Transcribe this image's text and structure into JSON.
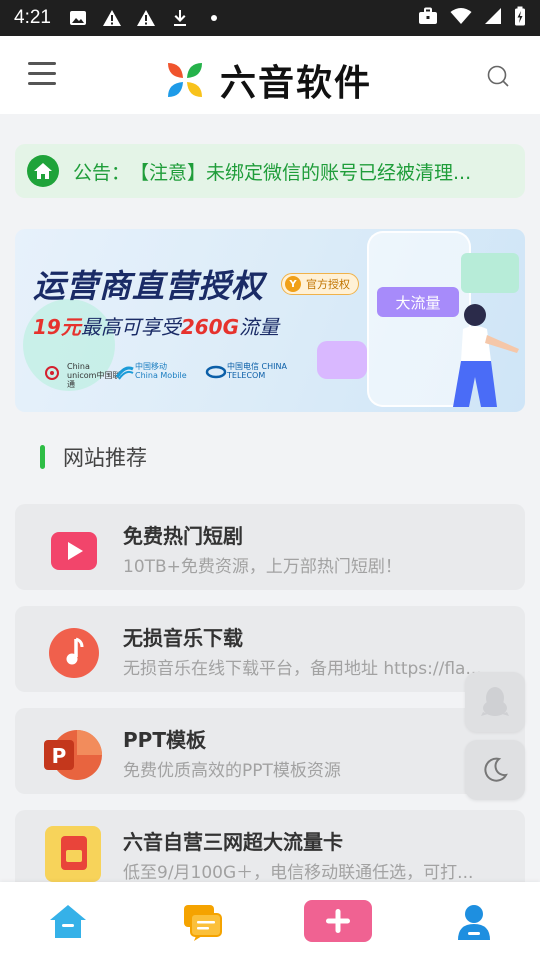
{
  "status_bar": {
    "time": "4:21",
    "icons_left": [
      "image-icon",
      "warning-icon",
      "warning-icon",
      "download-icon",
      "dot-icon"
    ],
    "icons_right": [
      "briefcase-icon",
      "wifi-icon",
      "signal-icon",
      "battery-icon"
    ]
  },
  "header": {
    "title": "六音软件",
    "logo_colors": [
      "#f0542d",
      "#25b24a",
      "#1e9be8",
      "#f8c21b"
    ]
  },
  "notice": {
    "label": "公告：",
    "text": "【注意】未绑定微信的账号已经被清理..."
  },
  "banner": {
    "headline": "运营商直营授权",
    "badge": "官方授权",
    "badge_mark": "Y",
    "price": "19元",
    "mid": "最高可享受",
    "amount": "260G",
    "suffix": "流量",
    "flow_tag": "大流量",
    "carriers": [
      {
        "name": "China unicom中国联通"
      },
      {
        "name": "中国移动 China Mobile"
      },
      {
        "name": "中国电信 CHINA TELECOM"
      }
    ]
  },
  "section": {
    "title": "网站推荐"
  },
  "items": [
    {
      "title": "免费热门短剧",
      "desc": "10TB+免费资源，上万部热门短剧！",
      "icon": "play-icon"
    },
    {
      "title": "无损音乐下载",
      "desc": "无损音乐在线下载平台，备用地址 https://fla...",
      "icon": "music-note-icon"
    },
    {
      "title": "PPT模板",
      "desc": "免费优质高效的PPT模板资源",
      "icon": "powerpoint-icon"
    },
    {
      "title": "六音自营三网超大流量卡",
      "desc": "低至9/月100G＋，电信移动联通任选，可打...",
      "icon": "sim-card-icon"
    }
  ],
  "floating": [
    "qq-icon",
    "moon-icon"
  ],
  "bottom_nav": [
    "home-icon",
    "chat-icon",
    "add-icon",
    "user-icon"
  ],
  "colors": {
    "accent_green": "#1f9d3a",
    "nav_blue": "#1e9be8",
    "nav_orange": "#f5a300",
    "nav_pink": "#f06292"
  }
}
